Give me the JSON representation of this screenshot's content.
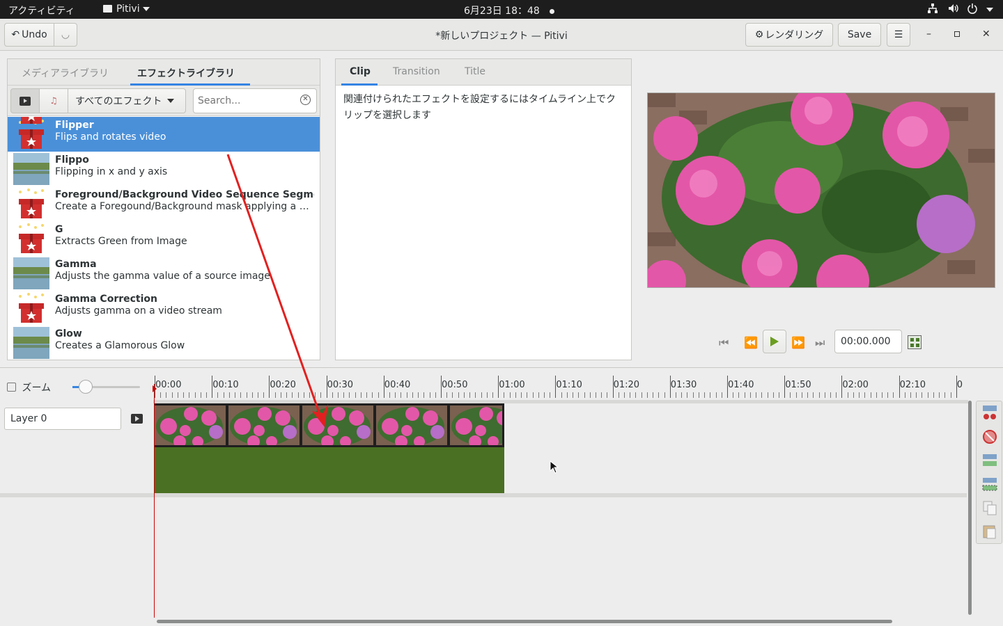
{
  "topbar": {
    "activities": "アクティビティ",
    "app_menu": "Pitivi",
    "clock": "6月23日 18：48"
  },
  "header": {
    "undo": "Undo",
    "title": "*新しいプロジェクト — Pitivi",
    "render": "レンダリング",
    "save": "Save"
  },
  "library": {
    "tabs": [
      "メディアライブラリ",
      "エフェクトライブラリ"
    ],
    "category": "すべてのエフェクト",
    "search_placeholder": "Search...",
    "items": [
      {
        "name": "Flipper",
        "desc": "Flips and rotates video",
        "thumb": "gift-icon",
        "selected": true
      },
      {
        "name": "Flippo",
        "desc": "Flipping in x and y axis",
        "thumb": "lake-thumbnail",
        "selected": false
      },
      {
        "name": "Foreground/Background Video Sequence Segmen...",
        "desc": "Create a Foregound/Background mask applying a par...",
        "thumb": "gift-icon",
        "selected": false
      },
      {
        "name": "G",
        "desc": "Extracts Green from Image",
        "thumb": "gift-icon",
        "selected": false
      },
      {
        "name": "Gamma",
        "desc": "Adjusts the gamma value of a source image",
        "thumb": "lake-thumbnail",
        "selected": false
      },
      {
        "name": "Gamma Correction",
        "desc": "Adjusts gamma on a video stream",
        "thumb": "gift-icon",
        "selected": false
      },
      {
        "name": "Glow",
        "desc": "Creates a Glamorous Glow",
        "thumb": "lake-thumbnail",
        "selected": false
      }
    ]
  },
  "clip_panel": {
    "tabs": [
      "Clip",
      "Transition",
      "Title"
    ],
    "message": "関連付けられたエフェクトを設定するにはタイムライン上でクリップを選択します"
  },
  "viewer": {
    "timecode": "00:00.000"
  },
  "timeline": {
    "zoom_label": "ズーム",
    "layer_name": "Layer 0",
    "ticks": [
      "00:00",
      "00:10",
      "00:20",
      "00:30",
      "00:40",
      "00:50",
      "01:00",
      "01:10",
      "01:20",
      "01:30",
      "01:40",
      "01:50",
      "02:00",
      "02:10",
      "0"
    ]
  },
  "colors": {
    "accent": "#3584e4",
    "selection": "#4a90d9",
    "audio_track": "#4a7023",
    "playhead": "#cc0000",
    "annotation_arrow": "#e32020"
  }
}
